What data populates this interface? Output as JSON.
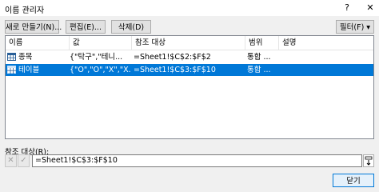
{
  "window": {
    "title": "이름 관리자",
    "help_glyph": "?",
    "close_glyph": "✕"
  },
  "toolbar": {
    "new_label": "새로 만들기(N)...",
    "edit_label": "편집(E)...",
    "delete_label": "삭제(D)",
    "filter_label": "필터(F) ▾"
  },
  "list": {
    "columns": [
      "이름",
      "값",
      "참조 대상",
      "범위",
      "설명"
    ],
    "rows": [
      {
        "name": "종목",
        "value": "{\"탁구\",\"테니...",
        "refers_to": "=Sheet1!$C$2:$F$2",
        "scope": "통합 ...",
        "comment": "",
        "selected": false
      },
      {
        "name": "테이블",
        "value": "{\"O\",\"O\",\"X\",\"X...",
        "refers_to": "=Sheet1!$C$3:$F$10",
        "scope": "통합 ...",
        "comment": "",
        "selected": true
      }
    ]
  },
  "reference": {
    "label": "참조 대상(R):",
    "value": "=Sheet1!$C$3:$F$10",
    "cancel_glyph": "✕",
    "confirm_glyph": "✓"
  },
  "footer": {
    "close_label": "닫기"
  },
  "colors": {
    "selection": "#0078d7",
    "table_icon": "#2a6099"
  }
}
